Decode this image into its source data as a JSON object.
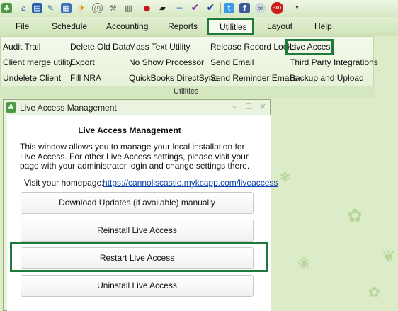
{
  "toolbar": {
    "icons": [
      "app-icon",
      "home-icon",
      "book-icon",
      "pencil-icon",
      "calculator-icon",
      "clock-icon",
      "wrench-icon",
      "piano-icon",
      "apple-icon",
      "graduation-cap-icon",
      "arrow-icon",
      "checkmark-purple-icon",
      "checkmark-blue-icon",
      "twitter-icon",
      "facebook-icon",
      "link-icon",
      "exit-icon",
      "dropdown-arrow-icon"
    ],
    "exit_label": "EXIT"
  },
  "ribbon": {
    "tabs": [
      "File",
      "Schedule",
      "Accounting",
      "Reports",
      "Utilities",
      "Layout",
      "Help"
    ],
    "active_tab": "Utilities",
    "group_label": "Utilities",
    "items": {
      "audit_trail": "Audit Trail",
      "client_merge_utility": "Client merge utility",
      "undelete_client": "Undelete Client",
      "delete_old_data": "Delete Old Data",
      "export": "Export",
      "fill_nra": "Fill NRA",
      "mass_text_utility": "Mass Text Utility",
      "no_show_processor": "No Show Processor",
      "quickbooks_directsync": "QuickBooks DirectSync",
      "release_record_locks": "Release Record Locks",
      "send_email": "Send Email",
      "send_reminder_emails": "Send Reminder Emails",
      "live_access": "Live Access",
      "third_party_integrations": "Third Party Integrations",
      "backup_and_upload": "Backup and Upload"
    }
  },
  "dialog": {
    "title": "Live Access Management",
    "heading": "Live Access Management",
    "description": "This window allows you to manage your local installation for Live Access. For other Live Access settings, please visit your page with your administrator login and change settings there.",
    "homepage_label": "Visit your homepage:",
    "homepage_url": "https://cannoliscastle.mykcapp.com/liveaccess",
    "buttons": {
      "download_updates": "Download Updates (if available) manually",
      "reinstall": "Reinstall Live Access",
      "restart": "Restart Live Access",
      "uninstall": "Uninstall Live Access"
    }
  },
  "colors": {
    "highlight": "#1d7a3c",
    "background": "#dcecc8",
    "link": "#0a44a8"
  }
}
